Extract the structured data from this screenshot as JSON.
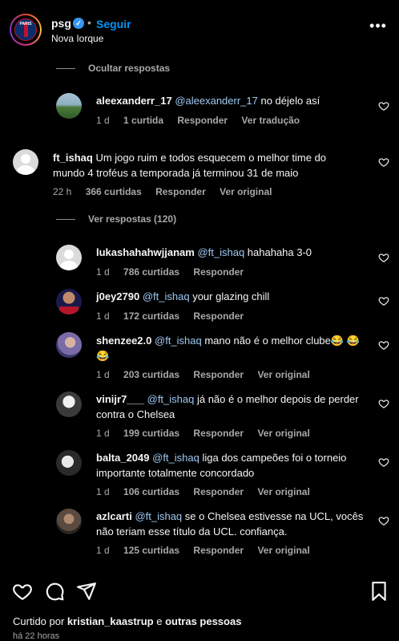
{
  "header": {
    "username": "psg",
    "dot": "•",
    "follow_label": "Seguir",
    "location": "Nova Iorque",
    "logo_text": "PARIS",
    "more_icon": "more-horizontal-icon"
  },
  "thread": {
    "hide_replies_label": "Ocultar respostas",
    "view_replies_label": "Ver respostas (120)",
    "comments": [
      {
        "user": "aleexanderr_17",
        "mention": "@aleexanderr_17",
        "text": " no déjelo así",
        "time": "1 d",
        "likes": "1 curtida",
        "reply": "Responder",
        "extra": "Ver tradução"
      },
      {
        "user": "ft_ishaq",
        "mention": "",
        "text": " Um jogo ruim e todos esquecem o melhor time do mundo 4 troféus a temporada já terminou 31 de maio",
        "time": "22 h",
        "likes": "366 curtidas",
        "reply": "Responder",
        "extra": "Ver original"
      },
      {
        "user": "lukashahahwjjanam",
        "mention": "@ft_ishaq",
        "text": " hahahaha 3-0",
        "time": "1 d",
        "likes": "786 curtidas",
        "reply": "Responder",
        "extra": ""
      },
      {
        "user": "j0ey2790",
        "mention": "@ft_ishaq",
        "text": " your glazing chill",
        "time": "1 d",
        "likes": "172 curtidas",
        "reply": "Responder",
        "extra": ""
      },
      {
        "user": "shenzee2.0",
        "mention": "@ft_ishaq",
        "text": " mano não é o melhor clube😂 😂 😂",
        "time": "1 d",
        "likes": "203 curtidas",
        "reply": "Responder",
        "extra": "Ver original"
      },
      {
        "user": "vinijr7___",
        "mention": "@ft_ishaq",
        "text": " já não é o melhor depois de perder contra o Chelsea",
        "time": "1 d",
        "likes": "199 curtidas",
        "reply": "Responder",
        "extra": "Ver original"
      },
      {
        "user": "balta_2049",
        "mention": "@ft_ishaq",
        "text": " liga dos campeões foi o torneio importante totalmente concordado",
        "time": "1 d",
        "likes": "106 curtidas",
        "reply": "Responder",
        "extra": "Ver original"
      },
      {
        "user": "azlcarti",
        "mention": "@ft_ishaq",
        "text": " se o Chelsea estivesse na UCL, vocês não teriam esse título da UCL. confiança.",
        "time": "1 d",
        "likes": "125 curtidas",
        "reply": "Responder",
        "extra": "Ver original"
      }
    ]
  },
  "footer": {
    "liked_prefix": "Curtido por ",
    "liked_user": "kristian_kaastrup",
    "liked_mid": " e ",
    "liked_suffix": "outras pessoas",
    "time_ago": "há 22 horas",
    "icons": [
      "heart-icon",
      "comment-icon",
      "share-icon",
      "bookmark-icon"
    ]
  },
  "colors": {
    "background": "#000000",
    "accent": "#0095f6",
    "verified": "#3897f0",
    "secondary_text": "#a8a8a8"
  }
}
